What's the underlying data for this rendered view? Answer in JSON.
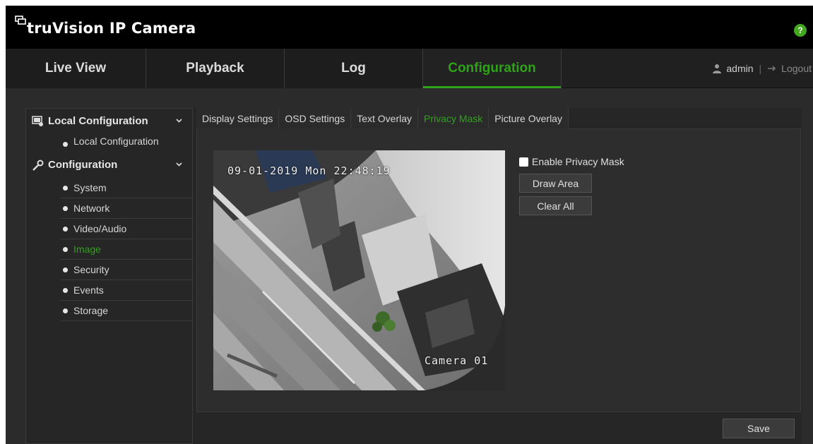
{
  "header": {
    "logo_text": "truVision IP Camera",
    "help_label": "?"
  },
  "nav": {
    "tabs": [
      {
        "label": "Live View"
      },
      {
        "label": "Playback"
      },
      {
        "label": "Log"
      },
      {
        "label": "Configuration"
      }
    ],
    "active_tab": "Configuration",
    "user": "admin",
    "separator": "|",
    "logout": "Logout"
  },
  "sidebar": {
    "sections": [
      {
        "title": "Local Configuration",
        "icon": "local-config-icon",
        "items": [
          {
            "label": "Local Configuration"
          }
        ]
      },
      {
        "title": "Configuration",
        "icon": "wrench-icon",
        "items": [
          {
            "label": "System"
          },
          {
            "label": "Network"
          },
          {
            "label": "Video/Audio"
          },
          {
            "label": "Image"
          },
          {
            "label": "Security"
          },
          {
            "label": "Events"
          },
          {
            "label": "Storage"
          }
        ]
      }
    ],
    "active_item": "Image"
  },
  "subtabs": [
    {
      "label": "Display Settings"
    },
    {
      "label": "OSD Settings"
    },
    {
      "label": "Text Overlay"
    },
    {
      "label": "Privacy Mask"
    },
    {
      "label": "Picture Overlay"
    }
  ],
  "active_subtab": "Privacy Mask",
  "video": {
    "osd_time": "09-01-2019 Mon 22:48:19",
    "osd_name": "Camera 01"
  },
  "privacy_mask": {
    "enable_label": "Enable Privacy Mask",
    "enabled": false,
    "draw_area_label": "Draw Area",
    "clear_all_label": "Clear All"
  },
  "save_label": "Save",
  "colors": {
    "accent": "#2ea319",
    "background": "#2b2b2b",
    "header": "#000000"
  }
}
